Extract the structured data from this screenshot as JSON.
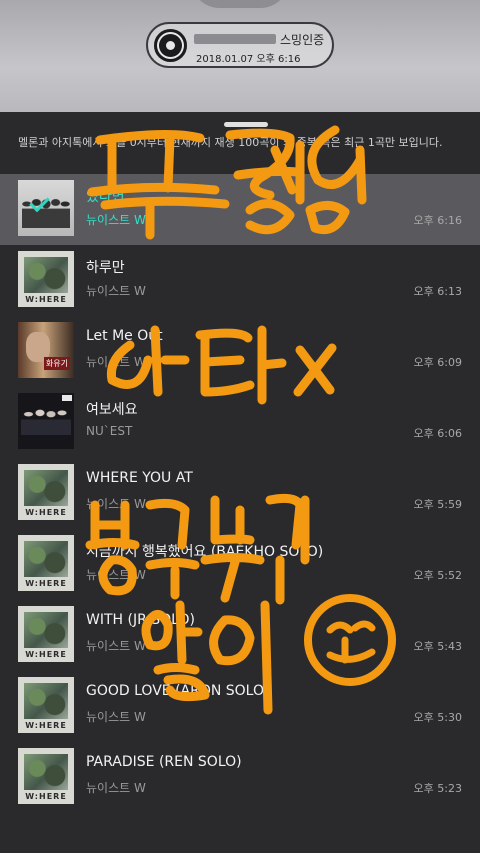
{
  "badge": {
    "title_suffix": "스밍인증",
    "datetime": "2018.01.07 오후 6:16"
  },
  "sheet": {
    "description": "멜론과 아지톡에서 오늘 0시부터 현재까지 재생 100곡이 되 중복 곡은 최근 1곡만 보입니다."
  },
  "tracks": [
    {
      "title": "있다면",
      "artist": "뉴이스트 W",
      "time": "오후 6:16",
      "selected": true,
      "art": "group"
    },
    {
      "title": "하루만",
      "artist": "뉴이스트 W",
      "time": "오후 6:13",
      "art": "where"
    },
    {
      "title": "Let Me Out",
      "artist": "뉴이스트 W",
      "time": "오후 6:09",
      "art": "drama"
    },
    {
      "title": "여보세요",
      "artist": "NU`EST",
      "time": "오후 6:06",
      "art": "hello"
    },
    {
      "title": "WHERE YOU AT",
      "artist": "뉴이스트 W",
      "time": "오후 5:59",
      "art": "where"
    },
    {
      "title": "지금까지 행복했어요 (BAEKHO SOLO)",
      "artist": "뉴이스트 W",
      "time": "오후 5:52",
      "art": "where"
    },
    {
      "title": "WITH (JR SOLO)",
      "artist": "뉴이스트 W",
      "time": "오후 5:43",
      "art": "where"
    },
    {
      "title": "GOOD LOVE (ARON SOLO)",
      "artist": "뉴이스트 W",
      "time": "오후 5:30",
      "art": "where"
    },
    {
      "title": "PARADISE (REN SOLO)",
      "artist": "뉴이스트 W",
      "time": "오후 5:23",
      "art": "where"
    }
  ],
  "album_label": "W:HERE",
  "drama_tag": "화유기",
  "overlay": {
    "handwriting": "팬톡전용 엔터X 방고쓰기 얇이 ㅃ",
    "color": "#f39a12"
  },
  "colors": {
    "accent_selected": "#33e0c8",
    "sheet_bg": "#2a2a2c"
  }
}
